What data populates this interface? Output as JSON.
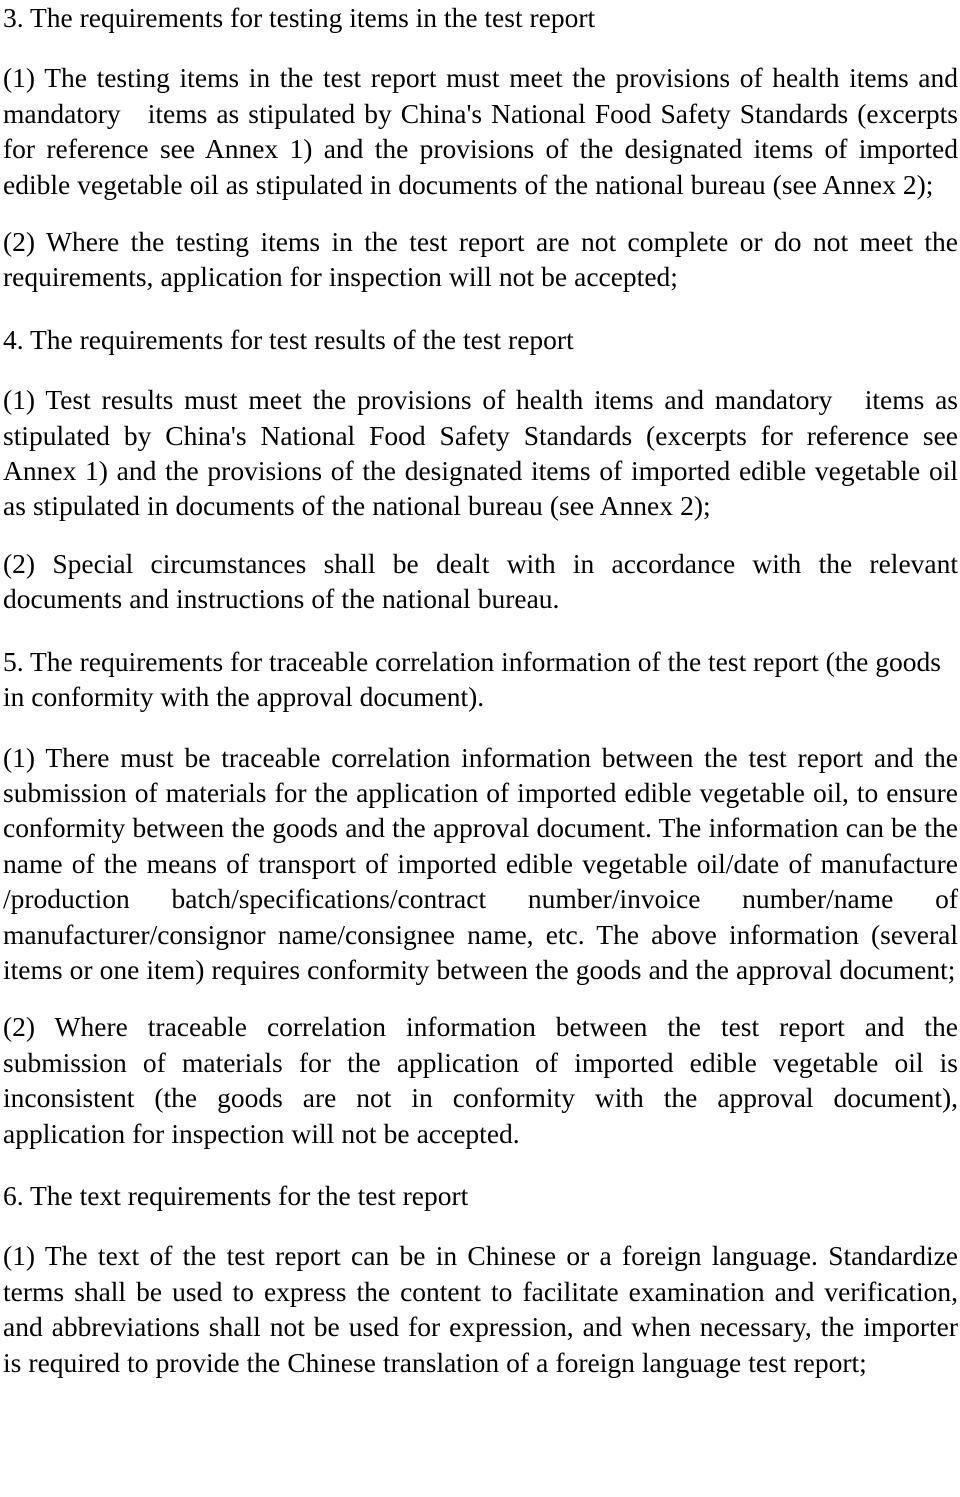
{
  "document": {
    "type": "regulatory-guidance-page",
    "language": "en",
    "sections": [
      {
        "id": "section-3",
        "heading": "3. The requirements for testing items in the test report",
        "paragraphs": [
          {
            "id": "s3-p1",
            "marker": "(1)",
            "text": "(1) The testing items in the test report must meet the provisions of health items and mandatory   items as stipulated by China's National Food Safety Standards (excerpts for reference see Annex 1) and the provisions of the designated items of imported edible vegetable oil as stipulated in documents of the national bureau (see Annex 2);"
          },
          {
            "id": "s3-p2",
            "marker": "(2)",
            "text": "(2) Where the testing items in the test report are not complete or do not meet the requirements, application for inspection will not be accepted;"
          }
        ]
      },
      {
        "id": "section-4",
        "heading": "4. The requirements for test results of the test report",
        "paragraphs": [
          {
            "id": "s4-p1",
            "marker": "(1)",
            "text": "(1) Test results must meet the provisions of health items and mandatory   items as stipulated by China's National Food Safety Standards (excerpts for reference see Annex 1) and the provisions of the designated items of imported edible vegetable oil as stipulated in documents of the national bureau (see Annex 2);"
          },
          {
            "id": "s4-p2",
            "marker": "(2)",
            "text": "(2) Special circumstances shall be dealt with in accordance with the relevant documents and instructions of the national bureau."
          }
        ]
      },
      {
        "id": "section-5",
        "heading": "5. The requirements for traceable correlation information of the test report (the goods in conformity with the approval document).",
        "paragraphs": [
          {
            "id": "s5-p1",
            "marker": "(1)",
            "text": "(1) There must be traceable correlation information between the test report and the submission of materials for the application of imported edible vegetable oil, to ensure conformity between the goods and the approval document. The information can be the name of the means of transport of imported edible vegetable oil/date of manufacture /production batch/specifications/contract number/invoice number/name of manufacturer/consignor name/consignee name, etc. The above information (several items or one item) requires conformity between the goods and the approval document;"
          },
          {
            "id": "s5-p2",
            "marker": "(2)",
            "text": "(2) Where traceable correlation information between the test report and the submission of materials for the application of imported edible vegetable oil is inconsistent (the goods are not in conformity with the approval document), application for inspection will not be accepted."
          }
        ]
      },
      {
        "id": "section-6",
        "heading": "6. The text requirements for the test report",
        "paragraphs": [
          {
            "id": "s6-p1",
            "marker": "(1)",
            "text": "(1) The text of the test report can be in Chinese or a foreign language. Standardize terms shall be used to express the content to facilitate examination and verification, and abbreviations shall not be used for expression, and when necessary, the importer is required to provide the Chinese translation of a foreign language test report;"
          }
        ]
      }
    ]
  },
  "style": {
    "text_color": "#000000",
    "background_color": "#ffffff"
  }
}
